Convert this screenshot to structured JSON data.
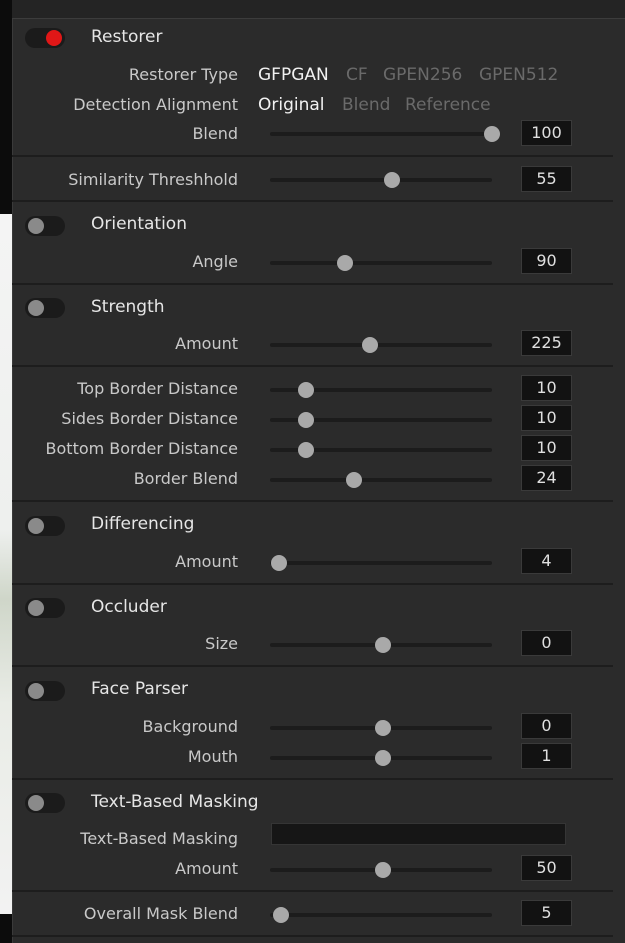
{
  "colors": {
    "accent_on": "#e01717",
    "panel_bg": "#2b2b2b",
    "field_bg": "#121212",
    "text": "#d6d6d6",
    "dim_text": "#6a6a6a"
  },
  "restorer": {
    "title": "Restorer",
    "toggle_on": true,
    "type_label": "Restorer Type",
    "type_options": [
      "GFPGAN",
      "CF",
      "GPEN256",
      "GPEN512"
    ],
    "type_selected": "GFPGAN",
    "align_label": "Detection Alignment",
    "align_options": [
      "Original",
      "Blend",
      "Reference"
    ],
    "align_selected": "Original",
    "blend_label": "Blend",
    "blend_value": "100",
    "blend_level": 1.0
  },
  "similarity": {
    "label": "Similarity Threshhold",
    "value": "55",
    "level": 0.55
  },
  "orientation": {
    "title": "Orientation",
    "toggle_on": false,
    "angle_label": "Angle",
    "angle_value": "90",
    "angle_level": 0.34
  },
  "strength": {
    "title": "Strength",
    "toggle_on": false,
    "amount_label": "Amount",
    "amount_value": "225",
    "amount_level": 0.45
  },
  "border": {
    "top_label": "Top Border Distance",
    "top_value": "10",
    "top_level": 0.16,
    "sides_label": "Sides Border Distance",
    "sides_value": "10",
    "sides_level": 0.16,
    "bottom_label": "Bottom Border Distance",
    "bottom_value": "10",
    "bottom_level": 0.16,
    "blend_label": "Border Blend",
    "blend_value": "24",
    "blend_level": 0.38
  },
  "differencing": {
    "title": "Differencing",
    "toggle_on": false,
    "amount_label": "Amount",
    "amount_value": "4",
    "amount_level": 0.04
  },
  "occluder": {
    "title": "Occluder",
    "toggle_on": false,
    "size_label": "Size",
    "size_value": "0",
    "size_level": 0.51
  },
  "face_parser": {
    "title": "Face Parser",
    "toggle_on": false,
    "background_label": "Background",
    "background_value": "0",
    "background_level": 0.51,
    "mouth_label": "Mouth",
    "mouth_value": "1",
    "mouth_level": 0.51
  },
  "text_masking": {
    "title": "Text-Based Masking",
    "toggle_on": false,
    "field_label": "Text-Based Masking",
    "field_value": "",
    "amount_label": "Amount",
    "amount_value": "50",
    "amount_level": 0.51
  },
  "overall": {
    "label": "Overall Mask Blend",
    "value": "5",
    "level": 0.05
  }
}
